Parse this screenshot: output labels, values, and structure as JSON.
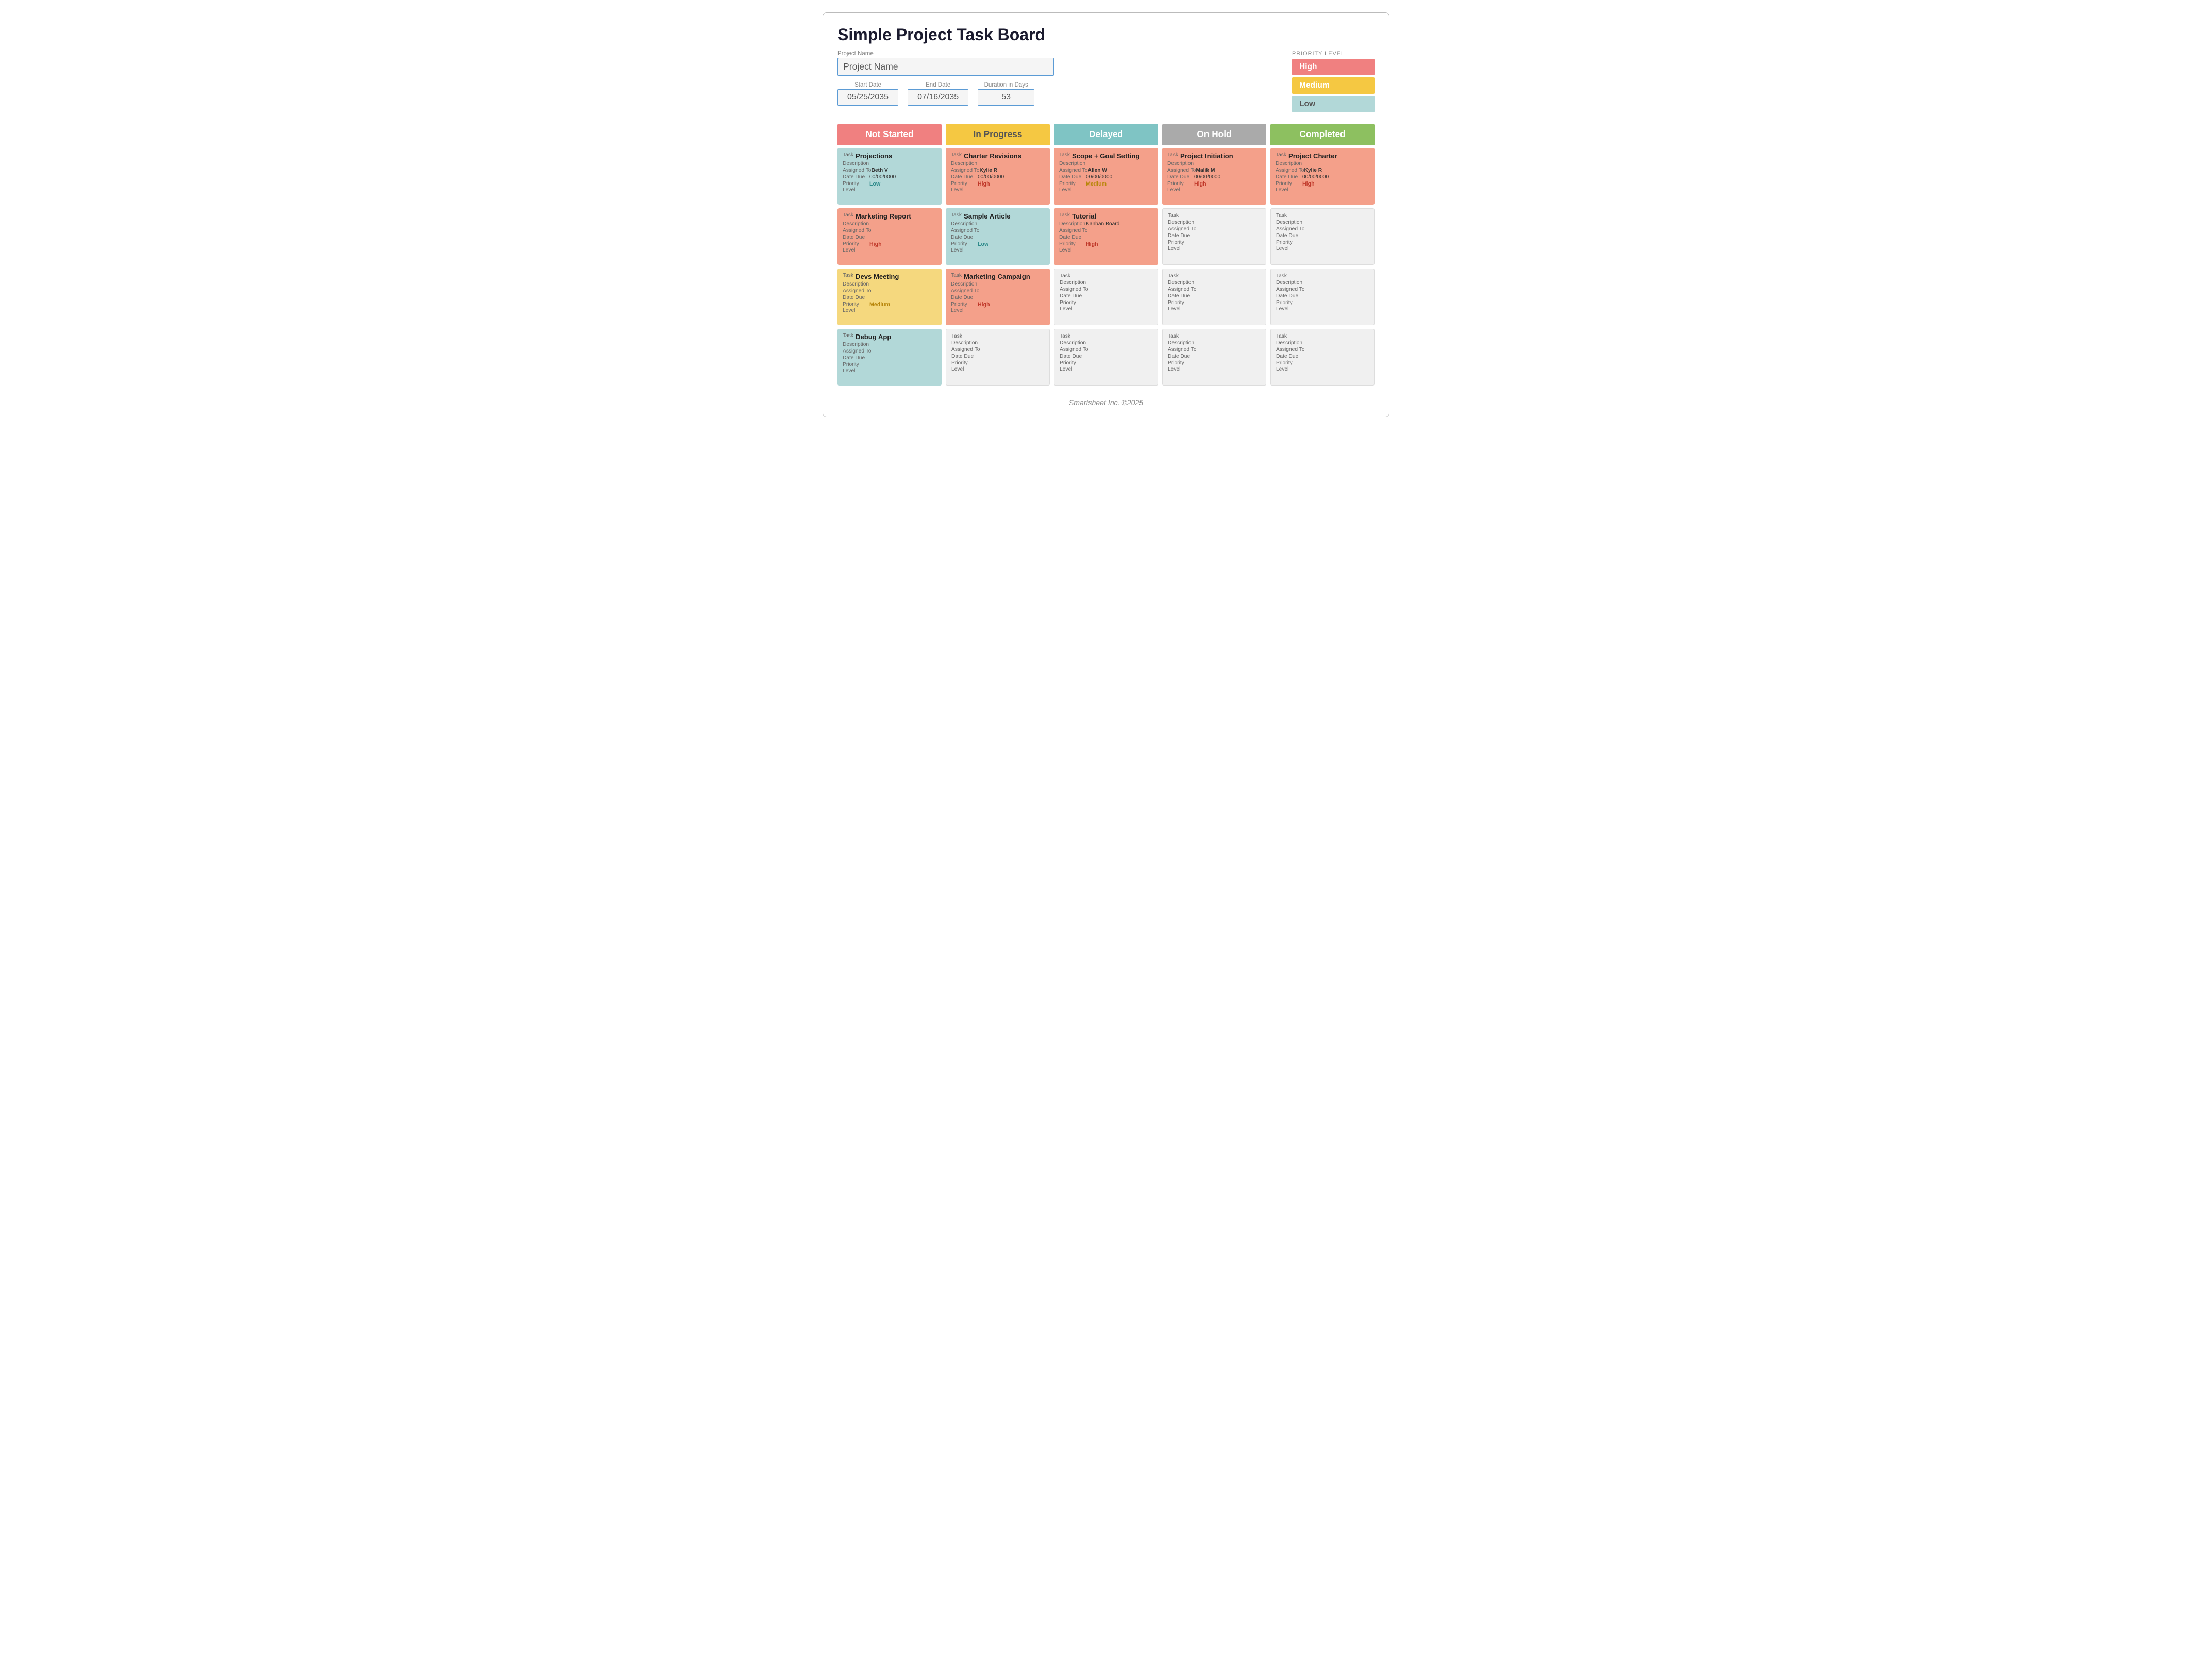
{
  "page": {
    "title": "Simple Project Task Board",
    "footer": "Smartsheet Inc. ©2025"
  },
  "project": {
    "name_label": "Project Name",
    "name_value": "Project Name",
    "start_label": "Start Date",
    "start_value": "05/25/2035",
    "end_label": "End Date",
    "end_value": "07/16/2035",
    "duration_label": "Duration in Days",
    "duration_value": "53"
  },
  "priority_legend": {
    "title": "PRIORITY LEVEL",
    "levels": [
      {
        "label": "High",
        "class": "priority-high"
      },
      {
        "label": "Medium",
        "class": "priority-medium"
      },
      {
        "label": "Low",
        "class": "priority-low"
      }
    ]
  },
  "columns": [
    {
      "id": "not-started",
      "label": "Not Started",
      "header_class": "col-not-started",
      "cards": [
        {
          "task": "Projections",
          "description": "Description",
          "assigned_to": "Beth V",
          "date_due": "00/00/0000",
          "priority": "Low",
          "color": "card-teal"
        },
        {
          "task": "Marketing Report",
          "description": "Description",
          "assigned_to": "",
          "date_due": "",
          "priority": "High",
          "color": "card-salmon"
        },
        {
          "task": "Devs Meeting",
          "description": "Description",
          "assigned_to": "",
          "date_due": "",
          "priority": "Medium",
          "color": "card-yellow"
        },
        {
          "task": "Debug App",
          "description": "Description",
          "assigned_to": "",
          "date_due": "",
          "priority": "",
          "color": "card-teal"
        }
      ]
    },
    {
      "id": "in-progress",
      "label": "In Progress",
      "header_class": "col-in-progress",
      "cards": [
        {
          "task": "Charter Revisions",
          "description": "Description",
          "assigned_to": "Kylie R",
          "date_due": "00/00/0000",
          "priority": "High",
          "color": "card-salmon"
        },
        {
          "task": "Sample Article",
          "description": "Description",
          "assigned_to": "",
          "date_due": "",
          "priority": "Low",
          "color": "card-teal"
        },
        {
          "task": "Marketing Campaign",
          "description": "Description",
          "assigned_to": "",
          "date_due": "",
          "priority": "High",
          "color": "card-salmon"
        },
        {
          "task": "",
          "description": "Description",
          "assigned_to": "",
          "date_due": "",
          "priority": "",
          "color": "card-empty"
        }
      ]
    },
    {
      "id": "delayed",
      "label": "Delayed",
      "header_class": "col-delayed",
      "cards": [
        {
          "task": "Scope + Goal Setting",
          "description": "Description",
          "assigned_to": "Allen W",
          "date_due": "00/00/0000",
          "priority": "Medium",
          "color": "card-salmon"
        },
        {
          "task": "Tutorial",
          "description": "Kanban Board",
          "assigned_to": "",
          "date_due": "",
          "priority": "High",
          "color": "card-salmon"
        },
        {
          "task": "",
          "description": "Description",
          "assigned_to": "",
          "date_due": "",
          "priority": "",
          "color": "card-empty"
        },
        {
          "task": "",
          "description": "Description",
          "assigned_to": "",
          "date_due": "",
          "priority": "",
          "color": "card-empty"
        }
      ]
    },
    {
      "id": "on-hold",
      "label": "On Hold",
      "header_class": "col-on-hold",
      "cards": [
        {
          "task": "Project Initiation",
          "description": "Description",
          "assigned_to": "Malik M",
          "date_due": "00/00/0000",
          "priority": "High",
          "color": "card-salmon"
        },
        {
          "task": "",
          "description": "Description",
          "assigned_to": "",
          "date_due": "",
          "priority": "",
          "color": "card-empty"
        },
        {
          "task": "",
          "description": "Description",
          "assigned_to": "",
          "date_due": "",
          "priority": "",
          "color": "card-empty"
        },
        {
          "task": "",
          "description": "Description",
          "assigned_to": "",
          "date_due": "",
          "priority": "",
          "color": "card-empty"
        }
      ]
    },
    {
      "id": "completed",
      "label": "Completed",
      "header_class": "col-completed",
      "cards": [
        {
          "task": "Project Charter",
          "description": "Description",
          "assigned_to": "Kylie R",
          "date_due": "00/00/0000",
          "priority": "High",
          "color": "card-salmon"
        },
        {
          "task": "",
          "description": "Description",
          "assigned_to": "",
          "date_due": "",
          "priority": "",
          "color": "card-empty"
        },
        {
          "task": "",
          "description": "Description",
          "assigned_to": "",
          "date_due": "",
          "priority": "",
          "color": "card-empty"
        },
        {
          "task": "",
          "description": "Description",
          "assigned_to": "",
          "date_due": "",
          "priority": "",
          "color": "card-empty"
        }
      ]
    }
  ]
}
